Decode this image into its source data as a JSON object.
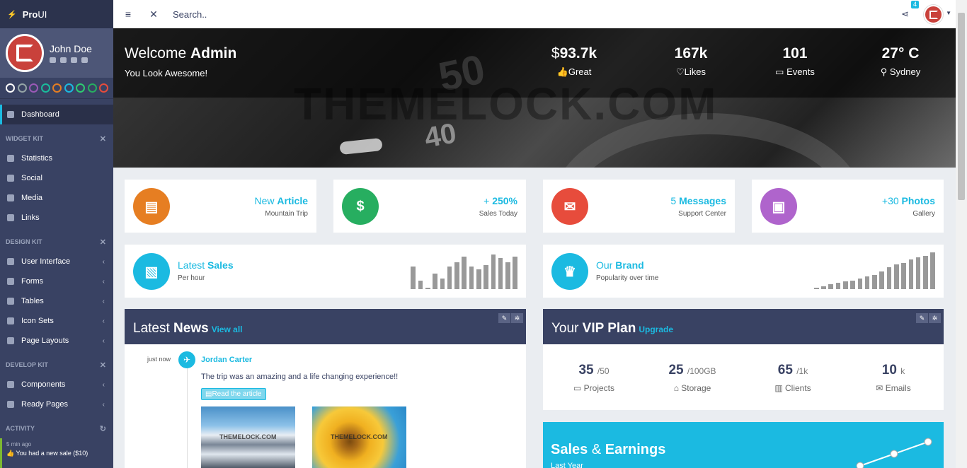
{
  "brand": {
    "name_bold": "Pro",
    "name_rest": "UI"
  },
  "user": {
    "name": "John Doe"
  },
  "themes": [
    "#ffffff",
    "#95a5a6",
    "#9b59b6",
    "#1abc9c",
    "#e67e22",
    "#1bbae1",
    "#2ecc71",
    "#27ae60",
    "#e74c3c"
  ],
  "nav": {
    "dashboard": "Dashboard",
    "widget_kit": "WIDGET KIT",
    "widget_items": [
      "Statistics",
      "Social",
      "Media",
      "Links"
    ],
    "design_kit": "DESIGN KIT",
    "design_items": [
      "User Interface",
      "Forms",
      "Tables",
      "Icon Sets",
      "Page Layouts"
    ],
    "develop_kit": "DEVELOP KIT",
    "develop_items": [
      "Components",
      "Ready Pages"
    ],
    "activity": "ACTIVITY"
  },
  "activity_item": {
    "time": "5 min ago",
    "message": "You had a new sale ($10)"
  },
  "topbar": {
    "search_placeholder": "Search..",
    "notifications_count": "4"
  },
  "hero": {
    "welcome_prefix": "Welcome",
    "welcome_name": "Admin",
    "tagline": "You Look Awesome!",
    "watermark": "THEMELOCK.COM",
    "stats": [
      {
        "currency": "$",
        "value": "93.7k",
        "label": "Great",
        "icon": "thumbs-up-icon"
      },
      {
        "currency": "",
        "value": "167k",
        "label": "Likes",
        "icon": "heart-icon"
      },
      {
        "currency": "",
        "value": "101",
        "label": "Events",
        "icon": "calendar-icon"
      },
      {
        "currency": "",
        "value": "27° C",
        "label": "Sydney",
        "icon": "map-marker-icon"
      }
    ]
  },
  "widgets": {
    "article": {
      "title_light": "New",
      "title_bold": "Article",
      "sub": "Mountain Trip",
      "color": "#e67e22"
    },
    "sales_today": {
      "title_light": "+",
      "title_bold": "250%",
      "sub": "Sales Today",
      "color": "#27ae60"
    },
    "messages": {
      "title_light": "5",
      "title_bold": "Messages",
      "sub": "Support Center",
      "color": "#e74c3c"
    },
    "photos": {
      "title_light": "+30",
      "title_bold": "Photos",
      "sub": "Gallery",
      "color": "#af64cc"
    },
    "latest_sales": {
      "title_light": "Latest",
      "title_bold": "Sales",
      "sub": "Per hour",
      "color": "#1bbae1",
      "bars": [
        32,
        12,
        2,
        22,
        15,
        32,
        38,
        46,
        32,
        28,
        34,
        49,
        44,
        38,
        46
      ]
    },
    "our_brand": {
      "title_light": "Our",
      "title_bold": "Brand",
      "sub": "Popularity over time",
      "color": "#1bbae1",
      "bars": [
        2,
        4,
        7,
        9,
        11,
        12,
        15,
        18,
        20,
        25,
        31,
        35,
        37,
        42,
        45,
        47,
        52
      ]
    }
  },
  "news": {
    "title_light": "Latest",
    "title_bold": "News",
    "view_all": "View all",
    "time": "just now",
    "author": "Jordan Carter",
    "text": "The trip was an amazing and a life changing experience!!",
    "button": "Read the article",
    "thumb_watermark": "THEMELOCK.COM"
  },
  "vip": {
    "title_light": "Your",
    "title_bold": "VIP Plan",
    "upgrade": "Upgrade",
    "stats": [
      {
        "value": "35",
        "total": "/50",
        "label": "Projects"
      },
      {
        "value": "25",
        "total": "/100GB",
        "label": "Storage"
      },
      {
        "value": "65",
        "total": "/1k",
        "label": "Clients"
      },
      {
        "value": "10",
        "total": "k",
        "label": "Emails"
      }
    ]
  },
  "sales_earnings": {
    "title_a": "Sales",
    "amp": "&",
    "title_b": "Earnings",
    "sub": "Last Year",
    "points": [
      1,
      2,
      3
    ]
  }
}
